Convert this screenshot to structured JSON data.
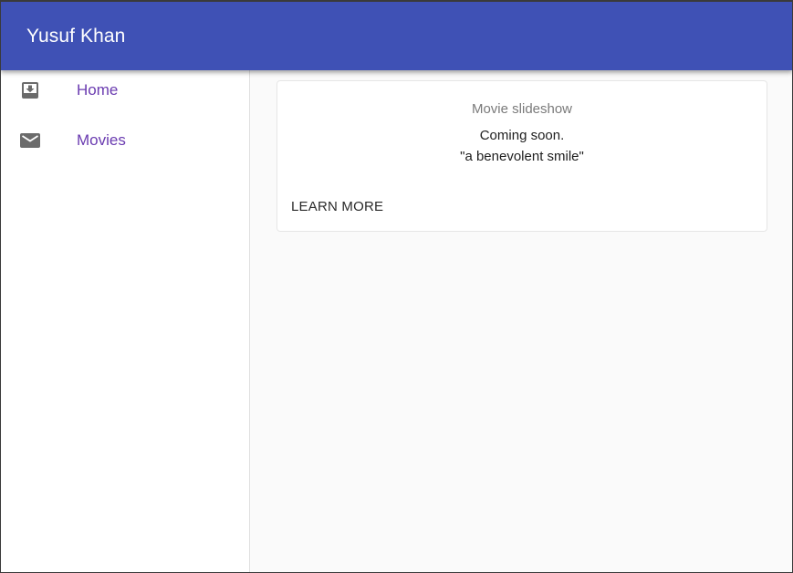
{
  "appbar": {
    "title": "Yusuf Khan",
    "color": "#3f51b5"
  },
  "sidebar": {
    "items": [
      {
        "label": "Home",
        "icon": "move-to-inbox-icon"
      },
      {
        "label": "Movies",
        "icon": "mail-icon"
      }
    ]
  },
  "card": {
    "title": "Movie slideshow",
    "line1": "Coming soon.",
    "line2": "\"a benevolent smile\"",
    "action_label": "LEARN MORE"
  }
}
